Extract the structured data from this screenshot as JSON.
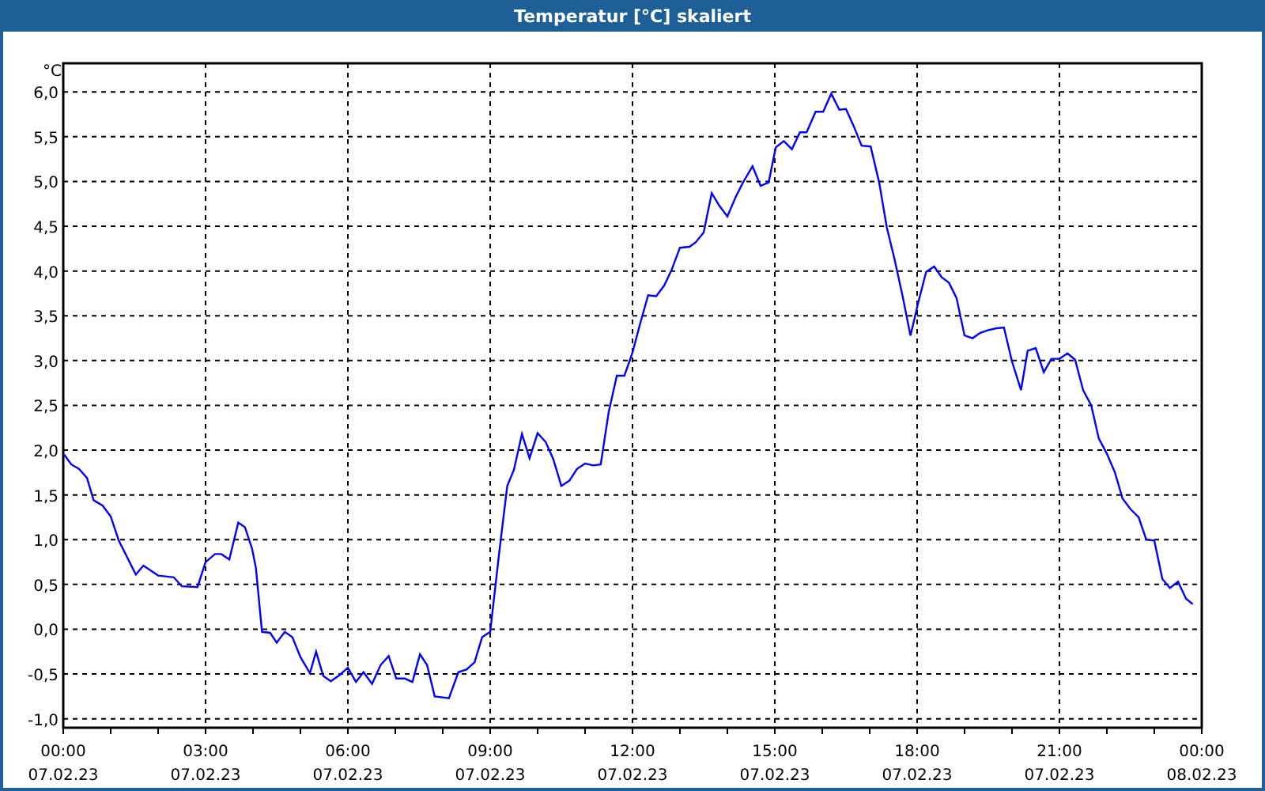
{
  "window": {
    "title": "Temperatur [°C] skaliert"
  },
  "chart": {
    "chart_data": {
      "type": "line",
      "grid": true,
      "ylabel": "°C",
      "x": [
        0.02,
        0.17,
        0.33,
        0.5,
        0.64,
        0.83,
        1.0,
        1.17,
        1.53,
        1.69,
        2.0,
        2.33,
        2.5,
        2.83,
        3.0,
        3.2,
        3.33,
        3.5,
        3.69,
        3.83,
        3.98,
        4.06,
        4.19,
        4.36,
        4.5,
        4.67,
        4.83,
        5.0,
        5.2,
        5.33,
        5.48,
        5.64,
        5.83,
        6.0,
        6.17,
        6.33,
        6.51,
        6.69,
        6.86,
        7.02,
        7.2,
        7.36,
        7.52,
        7.67,
        7.83,
        8.13,
        8.33,
        8.5,
        8.67,
        8.83,
        9.0,
        9.2,
        9.36,
        9.5,
        9.67,
        9.83,
        10.0,
        10.17,
        10.33,
        10.5,
        10.67,
        10.83,
        11.0,
        11.17,
        11.33,
        11.5,
        11.67,
        11.83,
        12.0,
        12.17,
        12.33,
        12.5,
        12.67,
        12.83,
        13.0,
        13.2,
        13.33,
        13.5,
        13.67,
        13.83,
        14.0,
        14.17,
        14.33,
        14.53,
        14.7,
        14.87,
        15.02,
        15.19,
        15.36,
        15.53,
        15.67,
        15.86,
        16.02,
        16.19,
        16.36,
        16.5,
        16.67,
        16.83,
        17.02,
        17.2,
        17.36,
        17.52,
        17.69,
        17.86,
        18.02,
        18.19,
        18.36,
        18.52,
        18.67,
        18.83,
        19.0,
        19.17,
        19.33,
        19.5,
        19.67,
        19.83,
        20.0,
        20.19,
        20.33,
        20.5,
        20.67,
        20.83,
        21.0,
        21.17,
        21.33,
        21.5,
        21.67,
        21.83,
        22.0,
        22.17,
        22.33,
        22.5,
        22.67,
        22.83,
        23.0,
        23.17,
        23.33,
        23.5,
        23.67,
        23.81
      ],
      "series": [
        {
          "color": "#0000ff",
          "values": [
            1.95,
            1.84,
            1.79,
            1.69,
            1.44,
            1.38,
            1.26,
            0.99,
            0.61,
            0.71,
            0.6,
            0.58,
            0.48,
            0.47,
            0.75,
            0.84,
            0.84,
            0.78,
            1.19,
            1.14,
            0.9,
            0.69,
            -0.03,
            -0.04,
            -0.15,
            -0.03,
            -0.09,
            -0.31,
            -0.49,
            -0.25,
            -0.52,
            -0.58,
            -0.51,
            -0.43,
            -0.59,
            -0.48,
            -0.61,
            -0.4,
            -0.3,
            -0.55,
            -0.55,
            -0.59,
            -0.28,
            -0.4,
            -0.75,
            -0.77,
            -0.48,
            -0.45,
            -0.37,
            -0.09,
            -0.03,
            0.9,
            1.6,
            1.78,
            2.18,
            1.91,
            2.19,
            2.09,
            1.9,
            1.6,
            1.66,
            1.79,
            1.85,
            1.83,
            1.84,
            2.43,
            2.83,
            2.83,
            3.09,
            3.43,
            3.73,
            3.72,
            3.84,
            4.02,
            4.26,
            4.27,
            4.32,
            4.43,
            4.87,
            4.73,
            4.61,
            4.82,
            4.99,
            5.17,
            4.95,
            4.99,
            5.38,
            5.45,
            5.36,
            5.55,
            5.55,
            5.78,
            5.78,
            5.98,
            5.8,
            5.81,
            5.61,
            5.4,
            5.39,
            4.99,
            4.49,
            4.14,
            3.73,
            3.28,
            3.64,
            3.99,
            4.05,
            3.93,
            3.87,
            3.7,
            3.28,
            3.25,
            3.31,
            3.34,
            3.36,
            3.37,
            2.99,
            2.67,
            3.11,
            3.14,
            2.87,
            3.02,
            3.02,
            3.08,
            3.01,
            2.67,
            2.5,
            2.13,
            1.96,
            1.75,
            1.46,
            1.34,
            1.25,
            1.0,
            0.99,
            0.56,
            0.46,
            0.53,
            0.34,
            0.28
          ]
        }
      ],
      "xlim": [
        0,
        24
      ],
      "ylim": [
        -1.1,
        6.32
      ],
      "xticks": [
        {
          "value": 0,
          "label": "00:00"
        },
        {
          "value": 3,
          "label": "03:00"
        },
        {
          "value": 6,
          "label": "06:00"
        },
        {
          "value": 9,
          "label": "09:00"
        },
        {
          "value": 12,
          "label": "12:00"
        },
        {
          "value": 15,
          "label": "15:00"
        },
        {
          "value": 18,
          "label": "18:00"
        },
        {
          "value": 21,
          "label": "21:00"
        },
        {
          "value": 24,
          "label": "00:00"
        }
      ],
      "yticks": [
        {
          "value": 6,
          "label": "6,0"
        },
        {
          "value": 5.5,
          "label": "5,5"
        },
        {
          "value": 5,
          "label": "5,0"
        },
        {
          "value": 4.5,
          "label": "4,5"
        },
        {
          "value": 4,
          "label": "4,0"
        },
        {
          "value": 3.5,
          "label": "3,5"
        },
        {
          "value": 3,
          "label": "3,0"
        },
        {
          "value": 2.5,
          "label": "2,5"
        },
        {
          "value": 2,
          "label": "2,0"
        },
        {
          "value": 1.5,
          "label": "1,5"
        },
        {
          "value": 1,
          "label": "1,0"
        },
        {
          "value": 0.5,
          "label": "0,5"
        },
        {
          "value": 0,
          "label": "0,0"
        },
        {
          "value": -0.5,
          "label": "-0,5"
        },
        {
          "value": -1,
          "label": "-1,0"
        }
      ]
    },
    "x_axis_dates": [
      "07.02.23",
      "07.02.23",
      "07.02.23",
      "07.02.23",
      "07.02.23",
      "07.02.23",
      "07.02.23",
      "07.02.23",
      "08.02.23"
    ]
  }
}
